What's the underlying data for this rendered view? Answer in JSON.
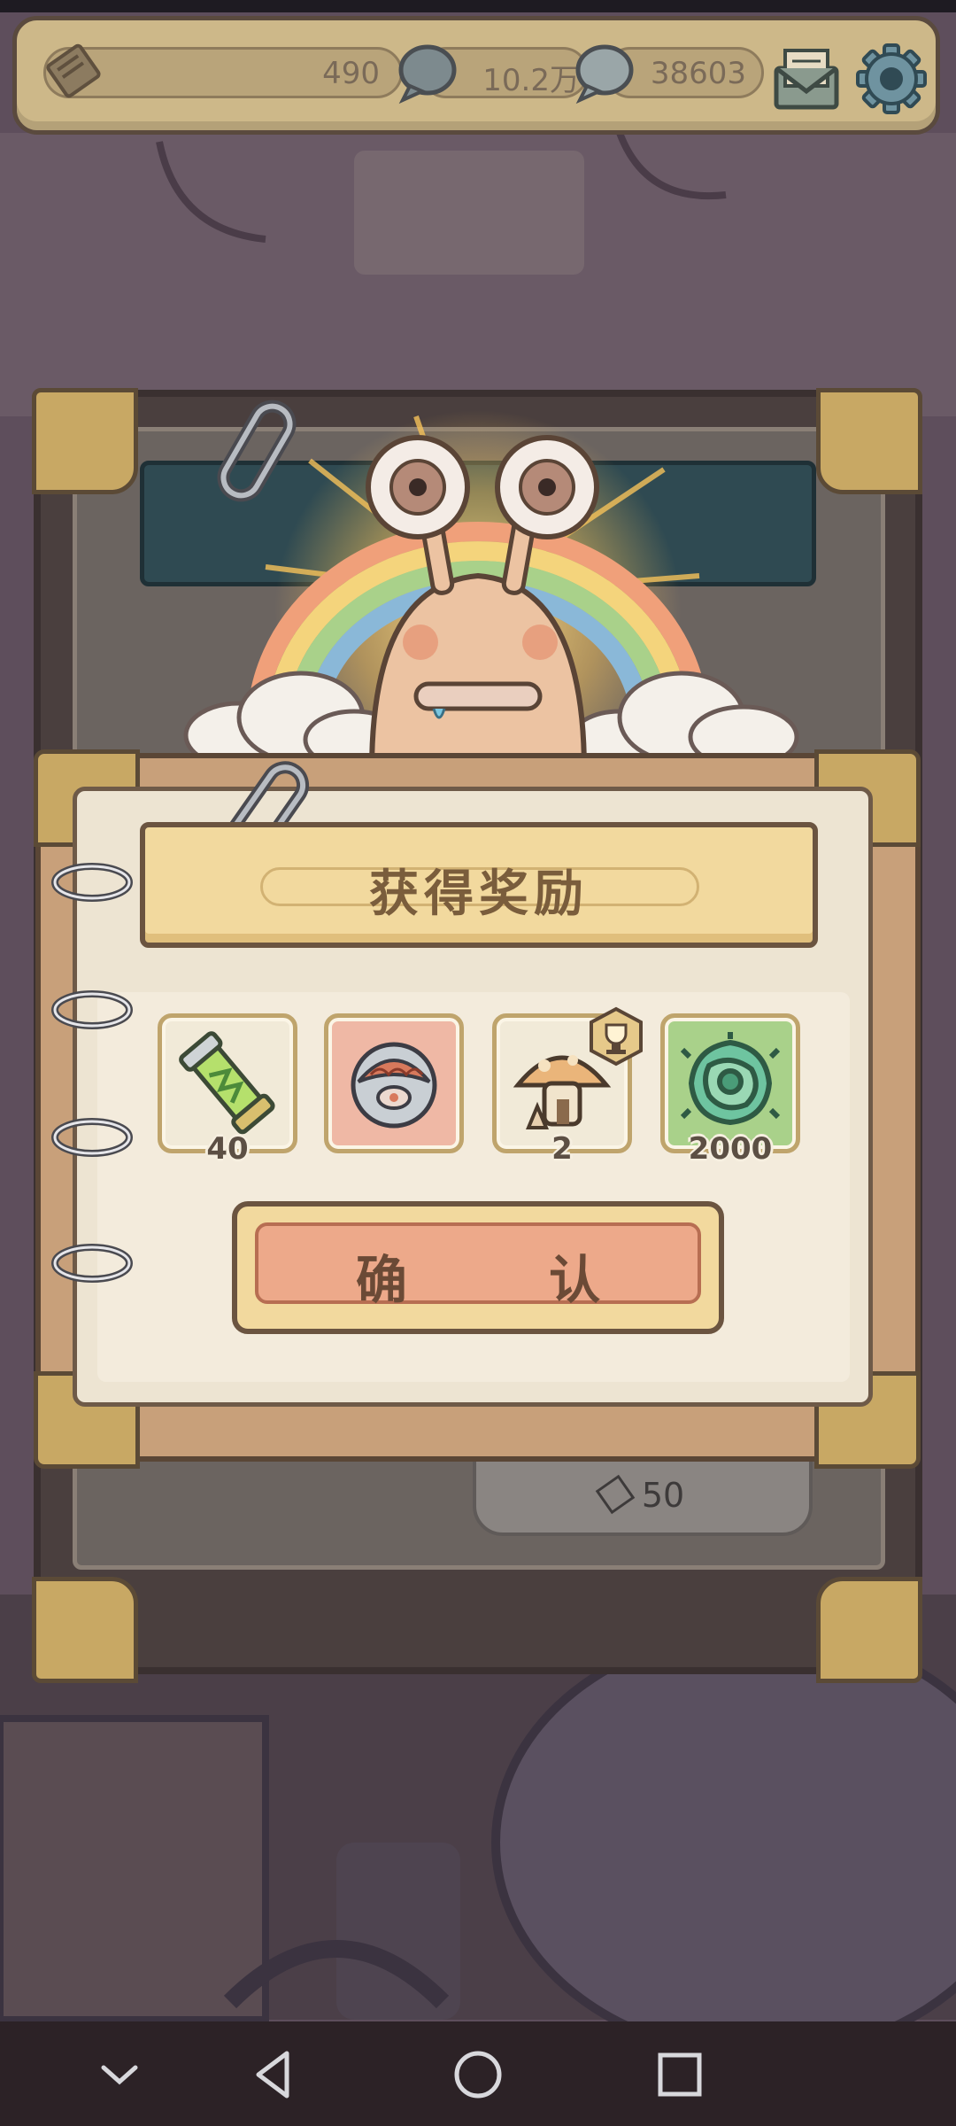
{
  "hud": {
    "currency1": {
      "icon": "ticket-icon",
      "value": "490"
    },
    "currency2": {
      "icon": "speech-bubble-icon",
      "value": "10.2万"
    },
    "currency3": {
      "icon": "speech-bubble-icon",
      "value": "38603"
    },
    "mail_icon": "mail-icon",
    "settings_icon": "gear-icon"
  },
  "background": {
    "price": "50",
    "price_icon": "ticket-icon"
  },
  "dialog": {
    "title": "获得奖励",
    "rewards": [
      {
        "icon": "green-tube-icon",
        "count": "40",
        "bg": "#f1ead8"
      },
      {
        "icon": "brain-orb-icon",
        "count": "",
        "bg": "#efb8a5"
      },
      {
        "icon": "mushroom-house-icon",
        "count": "2",
        "bg": "#f1ead8",
        "badge": "trophy-badge-icon"
      },
      {
        "icon": "green-virus-icon",
        "count": "2000",
        "bg": "#a9d18a"
      }
    ],
    "confirm_label": "确 认"
  },
  "navbar": {
    "back_icon": "chevron-down-icon",
    "triangle_icon": "back-triangle-icon",
    "home_icon": "home-circle-icon",
    "recents_icon": "recents-square-icon"
  },
  "colors": {
    "parchment": "#ede4d2",
    "banner": "#f2d99e",
    "confirm": "#eda98a",
    "frame": "#c8a07a"
  }
}
